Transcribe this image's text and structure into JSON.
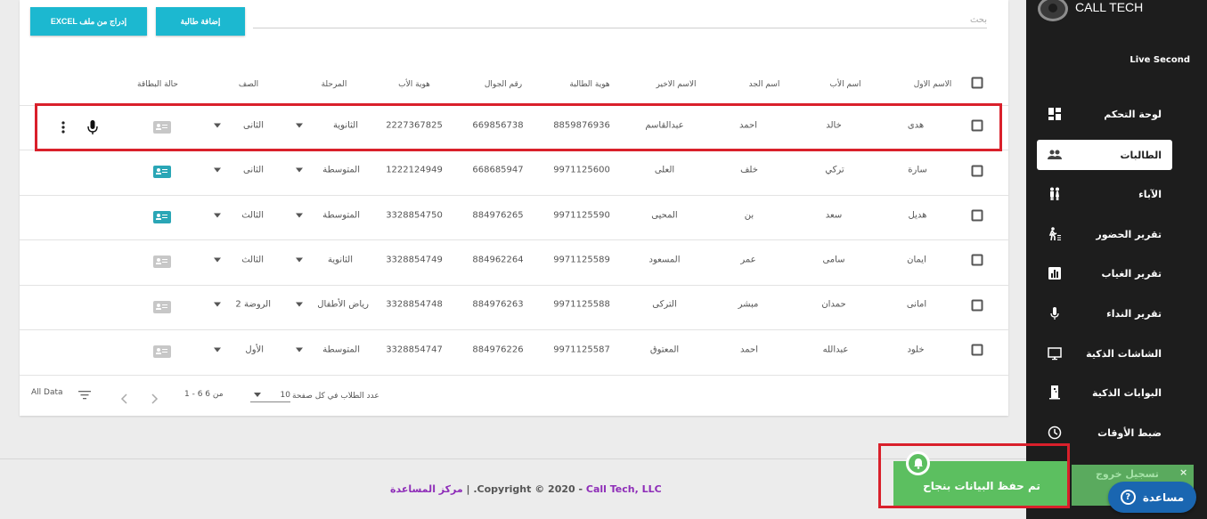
{
  "brand": {
    "name": "CALL TECH"
  },
  "sidebar": {
    "user": "Live Second",
    "items": [
      {
        "label": "لوحة التحكم",
        "icon": "dashboard-icon"
      },
      {
        "label": "الطالبات",
        "icon": "people-icon"
      },
      {
        "label": "الآباء",
        "icon": "parents-icon"
      },
      {
        "label": "تقرير الحضور",
        "icon": "attendance-icon"
      },
      {
        "label": "تقرير الغياب",
        "icon": "bar-chart-icon"
      },
      {
        "label": "تقرير النداء",
        "icon": "microphone-icon"
      },
      {
        "label": "الشاشات الذكية",
        "icon": "monitor-icon"
      },
      {
        "label": "البوابات الذكية",
        "icon": "door-icon"
      },
      {
        "label": "ضبط الأوقات",
        "icon": "clock-icon"
      }
    ]
  },
  "toolbar": {
    "search_placeholder": "بحث",
    "add_student": "إضافة طالبة",
    "import_excel": "EXCEL إدراج من ملف"
  },
  "table": {
    "headers": {
      "first_name": "الاسم الاول",
      "father_name": "اسم الأب",
      "grandfather_name": "اسم الجد",
      "last_name": "الاسم الاخير",
      "student_id": "هوية الطالبة",
      "mobile": "رقم الجوال",
      "father_id": "هوية الأب",
      "stage": "المرحلة",
      "grade": "الصف",
      "card_status": "حالة البطاقة"
    },
    "rows": [
      {
        "first": "هدى",
        "father": "خالد",
        "grandfather": "احمد",
        "last": "عبدالقاسم",
        "student_id": "8859876936",
        "mobile": "669856738",
        "father_id": "2227367825",
        "stage": "الثانوية",
        "grade": "الثانى",
        "card": "inactive"
      },
      {
        "first": "سارة",
        "father": "تركي",
        "grandfather": "خلف",
        "last": "العلى",
        "student_id": "9971125600",
        "mobile": "668685947",
        "father_id": "1222124949",
        "stage": "المتوسطة",
        "grade": "الثانى",
        "card": "active"
      },
      {
        "first": "هديل",
        "father": "سعد",
        "grandfather": "بن",
        "last": "المحيى",
        "student_id": "9971125590",
        "mobile": "884976265",
        "father_id": "3328854750",
        "stage": "المتوسطة",
        "grade": "الثالث",
        "card": "active"
      },
      {
        "first": "ايمان",
        "father": "سامى",
        "grandfather": "عمر",
        "last": "المسعود",
        "student_id": "9971125589",
        "mobile": "884962264",
        "father_id": "3328854749",
        "stage": "الثانوية",
        "grade": "الثالث",
        "card": "inactive"
      },
      {
        "first": "امانى",
        "father": "حمدان",
        "grandfather": "مبشر",
        "last": "الترکی",
        "student_id": "9971125588",
        "mobile": "884976263",
        "father_id": "3328854748",
        "stage": "رياض الأطفال",
        "grade": "الروضة 2",
        "card": "inactive"
      },
      {
        "first": "خلود",
        "father": "عبدالله",
        "grandfather": "احمد",
        "last": "المعتوق",
        "student_id": "9971125587",
        "mobile": "884976226",
        "father_id": "3328854747",
        "stage": "المتوسطة",
        "grade": "الأول",
        "card": "inactive"
      }
    ]
  },
  "pagination": {
    "per_page_label": "عدد الطلاب في كل صفحة",
    "per_page_value": "10",
    "range": "1 - 6 من 6",
    "all_data": "All Data"
  },
  "footer": {
    "copyright": ".Copyright © 2020 - ",
    "company": "Call Tech, LLC",
    "separator": " | ",
    "help_center": "مركز المساعدة"
  },
  "toast": {
    "message": "تم حفظ البيانات بنجاح",
    "back_message": "تسجيل خروج",
    "close": "×"
  },
  "help_button": {
    "label": "مساعدة",
    "icon": "?"
  },
  "colors": {
    "accent": "#1cb8d0",
    "sidebar": "#1d1d1d",
    "toast": "#5cbf60",
    "help": "#1a66b1",
    "highlight": "#d9202b"
  }
}
